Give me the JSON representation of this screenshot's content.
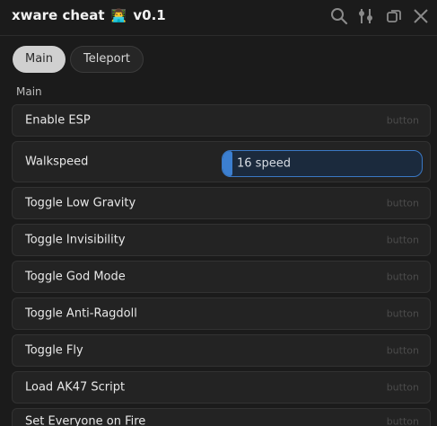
{
  "window": {
    "title_prefix": "xware cheat",
    "title_emoji": "👨‍💻",
    "title_suffix": "v0.1",
    "icons": [
      "search-icon",
      "settings-sliders-icon",
      "restore-icon",
      "close-icon"
    ]
  },
  "tabs": [
    {
      "label": "Main",
      "active": true
    },
    {
      "label": "Teleport",
      "active": false
    }
  ],
  "section": {
    "label": "Main"
  },
  "rows": [
    {
      "label": "Enable ESP",
      "hint": "button"
    },
    {
      "label": "Walkspeed",
      "slider": {
        "value_text": "16 speed",
        "fraction": 0.05
      }
    },
    {
      "label": "Toggle Low Gravity",
      "hint": "button"
    },
    {
      "label": "Toggle Invisibility",
      "hint": "button"
    },
    {
      "label": "Toggle God Mode",
      "hint": "button"
    },
    {
      "label": "Toggle Anti-Ragdoll",
      "hint": "button"
    },
    {
      "label": "Toggle Fly",
      "hint": "button"
    },
    {
      "label": "Load AK47 Script",
      "hint": "button"
    },
    {
      "label": "Set Everyone on Fire",
      "hint": "button"
    }
  ],
  "colors": {
    "background": "#1b1b1b",
    "row_background": "#232323",
    "accent": "#3c7fd0",
    "tab_active_bg": "#d0d0d0"
  }
}
